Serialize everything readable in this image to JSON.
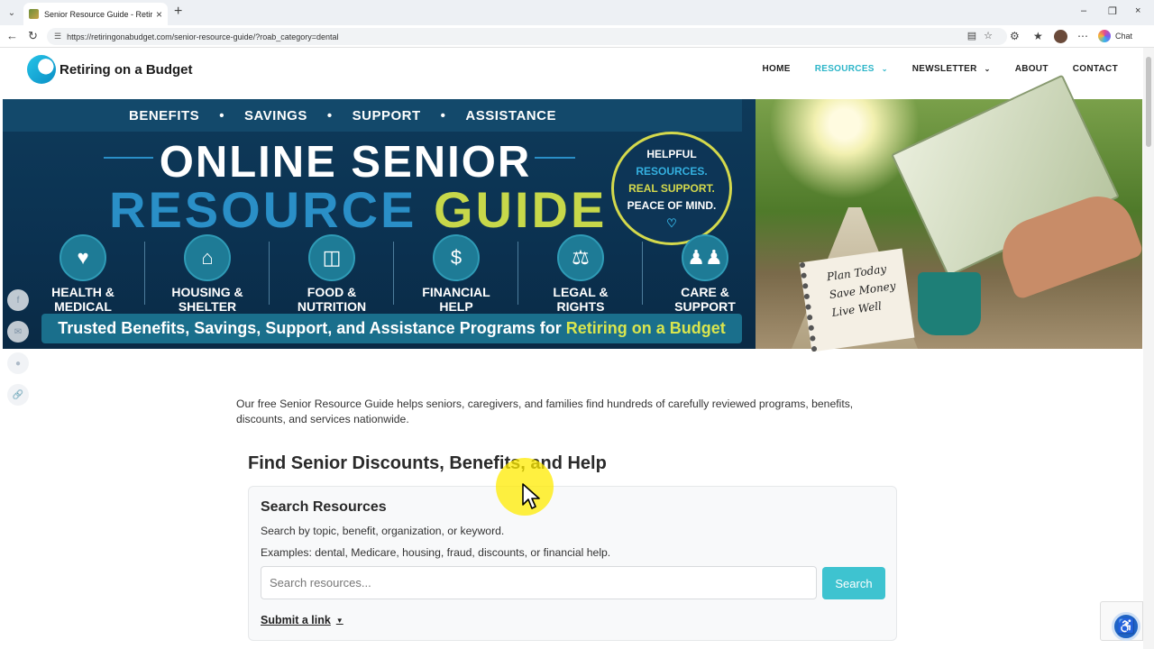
{
  "browser": {
    "tab_title": "Senior Resource Guide - Retiring o",
    "url": "https://retiringonabudget.com/senior-resource-guide/?roab_category=dental",
    "chat_label": "Chat"
  },
  "site": {
    "logo_text": "Retiring on a Budget",
    "nav": [
      {
        "label": "HOME"
      },
      {
        "label": "RESOURCES"
      },
      {
        "label": "NEWSLETTER"
      },
      {
        "label": "ABOUT"
      },
      {
        "label": "CONTACT"
      }
    ]
  },
  "hero": {
    "tags": [
      "BENEFITS",
      "SAVINGS",
      "SUPPORT",
      "ASSISTANCE"
    ],
    "title_line1": "ONLINE SENIOR",
    "title_line2a": "RESOURCE",
    "title_line2b": "GUIDE",
    "badge": {
      "l1": "HELPFUL",
      "l2": "RESOURCES.",
      "l3": "REAL SUPPORT.",
      "l4": "PEACE OF MIND."
    },
    "categories": [
      {
        "l1": "HEALTH &",
        "l2": "MEDICAL",
        "icon": "heart-pulse-icon"
      },
      {
        "l1": "HOUSING &",
        "l2": "SHELTER",
        "icon": "house-icon"
      },
      {
        "l1": "FOOD &",
        "l2": "NUTRITION",
        "icon": "basket-icon"
      },
      {
        "l1": "FINANCIAL",
        "l2": "HELP",
        "icon": "money-hand-icon"
      },
      {
        "l1": "LEGAL &",
        "l2": "RIGHTS",
        "icon": "scales-icon"
      },
      {
        "l1": "CARE &",
        "l2": "SUPPORT",
        "icon": "people-icon"
      }
    ],
    "bar_text": "Trusted Benefits, Savings, Support, and Assistance Programs for",
    "bar_highlight": "Retiring on a Budget",
    "note": {
      "l1": "Plan Today",
      "l2": "Save Money",
      "l3": "Live Well"
    }
  },
  "main": {
    "intro": "Our free Senior Resource Guide helps seniors, caregivers, and families find hundreds of carefully reviewed programs, benefits, discounts, and services nationwide.",
    "heading": "Find Senior Discounts, Benefits, and Help",
    "card": {
      "title": "Search Resources",
      "subtitle": "Search by topic, benefit, organization, or keyword.",
      "examples": "Examples: dental, Medicare, housing, fraud, discounts, or financial help.",
      "search_placeholder": "Search resources...",
      "search_button": "Search",
      "submit_link": "Submit a link"
    }
  },
  "colors": {
    "accent": "#2cb5c8",
    "search_button": "#3ec3d0",
    "hero_navy": "#0b3150",
    "hero_lime": "#c7d84a"
  }
}
